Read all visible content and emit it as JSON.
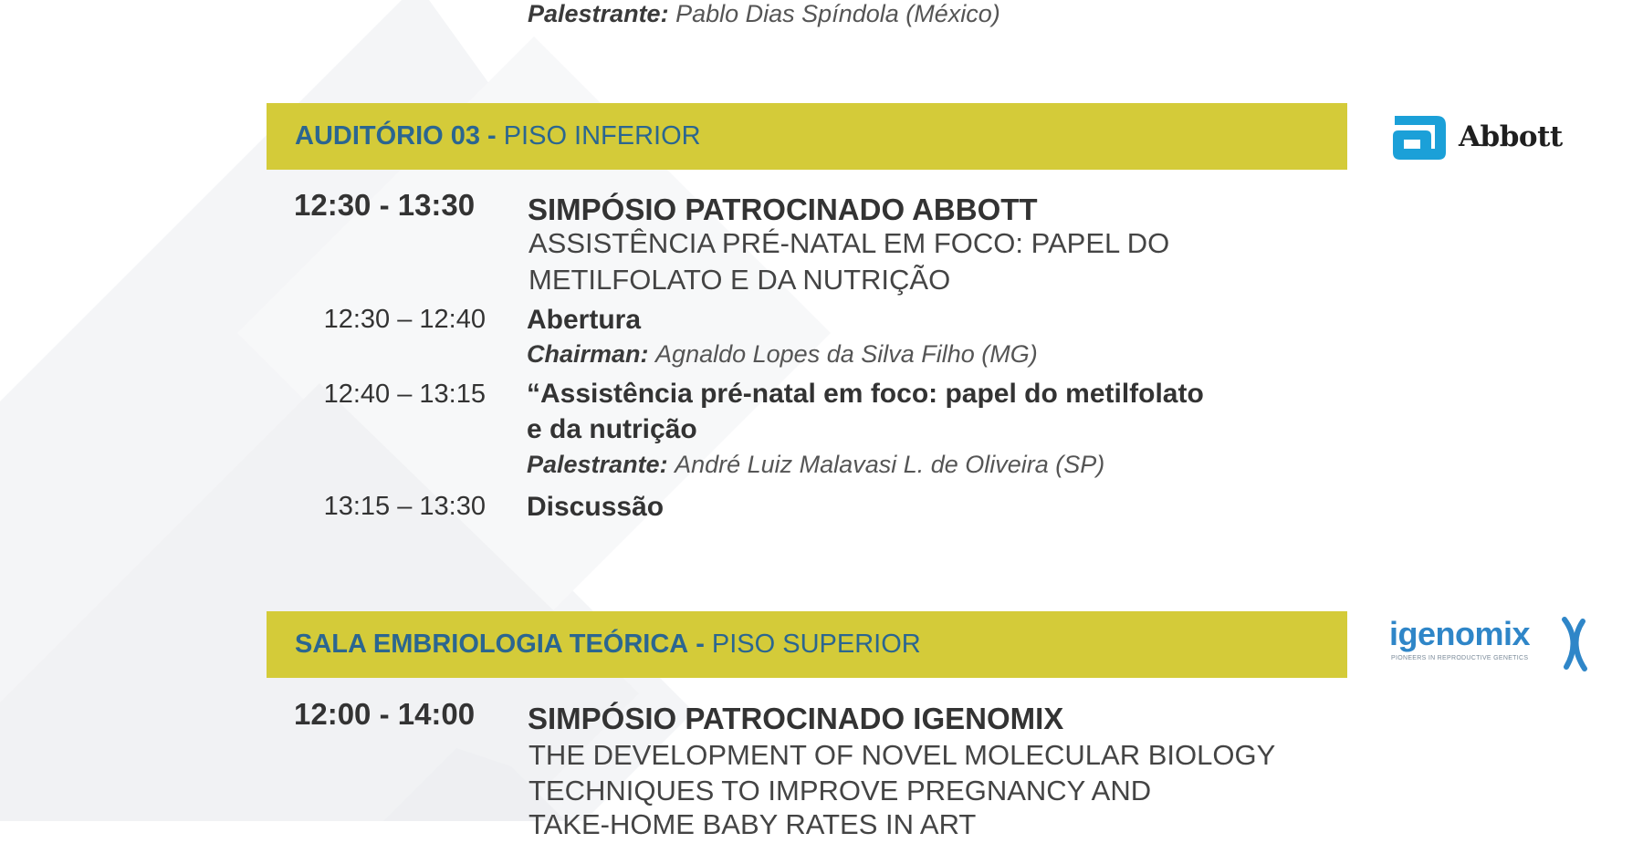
{
  "top": {
    "speaker_role": "Palestrante:",
    "speaker_name": "Pablo Dias Spíndola (México)"
  },
  "section1": {
    "room": "AUDITÓRIO 03",
    "separator": "-",
    "floor": "PISO INFERIOR",
    "sponsor_logo": "Abbott",
    "main_time": "12:30 - 13:30",
    "main_title": "SIMPÓSIO PATROCINADO ABBOTT",
    "subtitle_lines": [
      "ASSISTÊNCIA PRÉ-NATAL EM FOCO: PAPEL DO",
      "METILFOLATO E DA NUTRIÇÃO"
    ],
    "items": [
      {
        "time": "12:30 – 12:40",
        "title_lines": [
          "Abertura"
        ],
        "role": "Chairman:",
        "person": "Agnaldo Lopes da Silva Filho (MG)"
      },
      {
        "time": "12:40 – 13:15",
        "title_lines": [
          "“Assistência pré-natal em foco: papel do metilfolato",
          "e da nutrição"
        ],
        "role": "Palestrante:",
        "person": "André Luiz Malavasi L. de Oliveira (SP)"
      },
      {
        "time": "13:15 – 13:30",
        "title_lines": [
          "Discussão"
        ]
      }
    ]
  },
  "section2": {
    "room": "SALA EMBRIOLOGIA TEÓRICA",
    "separator": "-",
    "floor": "PISO SUPERIOR",
    "sponsor_logo": "igenomix",
    "sponsor_tagline": "PIONEERS IN REPRODUCTIVE GENETICS",
    "main_time": "12:00 - 14:00",
    "main_title": "SIMPÓSIO PATROCINADO IGENOMIX",
    "subtitle_lines": [
      "THE DEVELOPMENT OF NOVEL MOLECULAR BIOLOGY",
      "TECHNIQUES TO IMPROVE PREGNANCY AND",
      "TAKE-HOME BABY RATES IN ART"
    ]
  },
  "colors": {
    "bar_background": "#d4cb39",
    "room_text": "#2b6690",
    "abbott_blue": "#1ba0d8",
    "igenomix_blue": "#2f86c8",
    "background_shapes": "#f3f4f6"
  }
}
